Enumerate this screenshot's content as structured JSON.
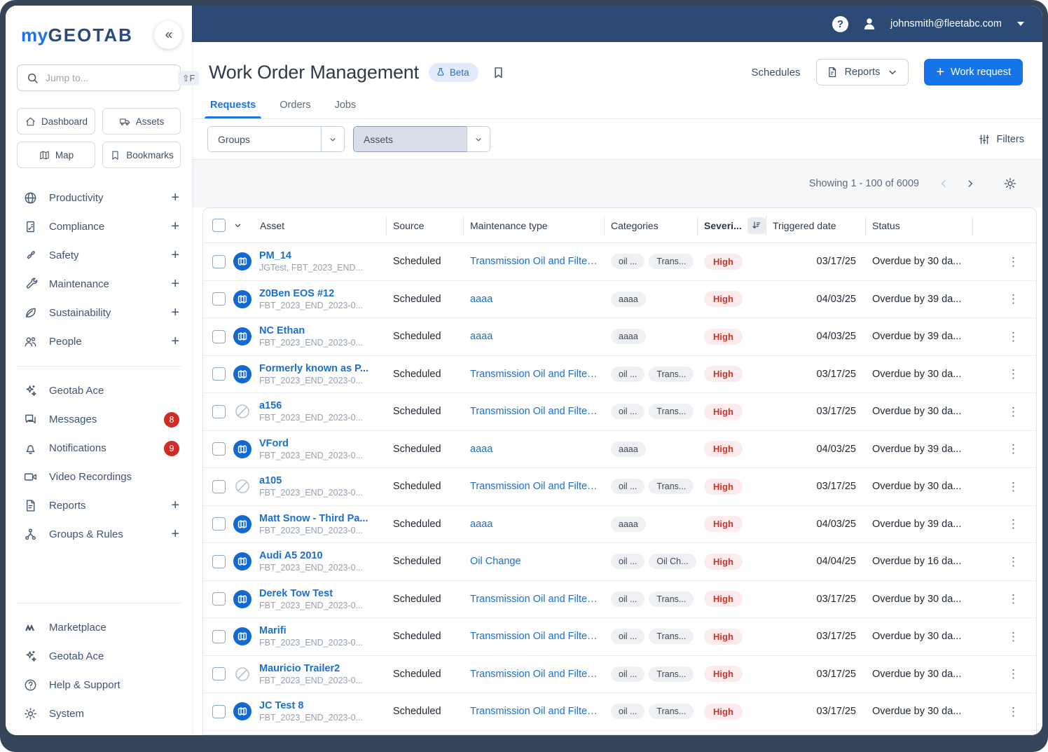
{
  "topbar": {
    "user_email": "johnsmith@fleetabc.com"
  },
  "sidebar": {
    "logo_my": "my",
    "logo_geotab": "GEOTAB",
    "search_placeholder": "Jump to...",
    "search_shortcut": "⇧F",
    "quick_links": [
      {
        "label": "Dashboard",
        "icon": "home"
      },
      {
        "label": "Assets",
        "icon": "truck"
      },
      {
        "label": "Map",
        "icon": "map"
      },
      {
        "label": "Bookmarks",
        "icon": "bookmark"
      }
    ],
    "nav": [
      {
        "label": "Productivity",
        "icon": "globe",
        "expandable": true
      },
      {
        "label": "Compliance",
        "icon": "clipboard",
        "expandable": true
      },
      {
        "label": "Safety",
        "icon": "belt",
        "expandable": true
      },
      {
        "label": "Maintenance",
        "icon": "wrench",
        "expandable": true
      },
      {
        "label": "Sustainability",
        "icon": "leaf",
        "expandable": true
      },
      {
        "label": "People",
        "icon": "people",
        "expandable": true
      }
    ],
    "tools": [
      {
        "label": "Geotab Ace",
        "icon": "sparkle"
      },
      {
        "label": "Messages",
        "icon": "chat",
        "badge": "8"
      },
      {
        "label": "Notifications",
        "icon": "bell",
        "badge": "9"
      },
      {
        "label": "Video Recordings",
        "icon": "video"
      },
      {
        "label": "Reports",
        "icon": "doc",
        "expandable": true
      },
      {
        "label": "Groups & Rules",
        "icon": "hierarchy",
        "expandable": true
      }
    ],
    "footer": [
      {
        "label": "Marketplace",
        "icon": "marketplace"
      },
      {
        "label": "Geotab Ace",
        "icon": "sparkle"
      },
      {
        "label": "Help & Support",
        "icon": "help"
      },
      {
        "label": "System",
        "icon": "gear"
      }
    ]
  },
  "header": {
    "title": "Work Order Management",
    "beta_label": "Beta",
    "schedules_label": "Schedules",
    "reports_label": "Reports",
    "work_request_label": "Work request",
    "tabs": [
      {
        "label": "Requests",
        "active": true
      },
      {
        "label": "Orders",
        "active": false
      },
      {
        "label": "Jobs",
        "active": false
      }
    ]
  },
  "filters": {
    "groups_label": "Groups",
    "assets_label": "Assets",
    "filters_label": "Filters"
  },
  "pagination": {
    "showing": "Showing 1 - 100 of 6009"
  },
  "table": {
    "columns": {
      "asset": "Asset",
      "source": "Source",
      "maintenance_type": "Maintenance type",
      "categories": "Categories",
      "severity": "Severi...",
      "triggered_date": "Triggered date",
      "status": "Status"
    },
    "rows": [
      {
        "asset": "PM_14",
        "subtitle": "JGTest, FBT_2023_END...",
        "icon": "geotab",
        "source": "Scheduled",
        "maintenance_type": "Transmission Oil and Filter...",
        "categories": [
          "oil ...",
          "Trans..."
        ],
        "severity": "High",
        "triggered_date": "03/17/25",
        "status": "Overdue by 30 da..."
      },
      {
        "asset": "Z0Ben EOS #12",
        "subtitle": "FBT_2023_END_2023-0...",
        "icon": "geotab",
        "source": "Scheduled",
        "maintenance_type": "aaaa",
        "categories": [
          "aaaa"
        ],
        "severity": "High",
        "triggered_date": "04/03/25",
        "status": "Overdue by 39 da..."
      },
      {
        "asset": "NC Ethan",
        "subtitle": "FBT_2023_END_2023-0...",
        "icon": "geotab",
        "source": "Scheduled",
        "maintenance_type": "aaaa",
        "categories": [
          "aaaa"
        ],
        "severity": "High",
        "triggered_date": "04/03/25",
        "status": "Overdue by 39 da..."
      },
      {
        "asset": "Formerly known as P...",
        "subtitle": "FBT_2023_END_2023-0...",
        "icon": "geotab",
        "source": "Scheduled",
        "maintenance_type": "Transmission Oil and Filter...",
        "categories": [
          "oil ...",
          "Trans..."
        ],
        "severity": "High",
        "triggered_date": "03/17/25",
        "status": "Overdue by 30 da..."
      },
      {
        "asset": "a156",
        "subtitle": "FBT_2023_END_2023-0...",
        "icon": "no-device",
        "source": "Scheduled",
        "maintenance_type": "Transmission Oil and Filter...",
        "categories": [
          "oil ...",
          "Trans..."
        ],
        "severity": "High",
        "triggered_date": "03/17/25",
        "status": "Overdue by 30 da..."
      },
      {
        "asset": "VFord",
        "subtitle": "FBT_2023_END_2023-0...",
        "icon": "geotab",
        "source": "Scheduled",
        "maintenance_type": "aaaa",
        "categories": [
          "aaaa"
        ],
        "severity": "High",
        "triggered_date": "04/03/25",
        "status": "Overdue by 39 da..."
      },
      {
        "asset": "a105",
        "subtitle": "FBT_2023_END_2023-0...",
        "icon": "no-device",
        "source": "Scheduled",
        "maintenance_type": "Transmission Oil and Filter...",
        "categories": [
          "oil ...",
          "Trans..."
        ],
        "severity": "High",
        "triggered_date": "03/17/25",
        "status": "Overdue by 30 da..."
      },
      {
        "asset": "Matt Snow - Third Pa...",
        "subtitle": "FBT_2023_END_2023-0...",
        "icon": "geotab",
        "source": "Scheduled",
        "maintenance_type": "aaaa",
        "categories": [
          "aaaa"
        ],
        "severity": "High",
        "triggered_date": "04/03/25",
        "status": "Overdue by 39 da..."
      },
      {
        "asset": "Audi A5 2010",
        "subtitle": "FBT_2023_END_2023-0...",
        "icon": "geotab",
        "source": "Scheduled",
        "maintenance_type": "Oil Change",
        "categories": [
          "oil ...",
          "Oil Ch..."
        ],
        "severity": "High",
        "triggered_date": "04/04/25",
        "status": "Overdue by 16 da..."
      },
      {
        "asset": "Derek Tow Test",
        "subtitle": "FBT_2023_END_2023-0...",
        "icon": "geotab",
        "source": "Scheduled",
        "maintenance_type": "Transmission Oil and Filter...",
        "categories": [
          "oil ...",
          "Trans..."
        ],
        "severity": "High",
        "triggered_date": "03/17/25",
        "status": "Overdue by 30 da..."
      },
      {
        "asset": "Marifi",
        "subtitle": "FBT_2023_END_2023-0...",
        "icon": "geotab",
        "source": "Scheduled",
        "maintenance_type": "Transmission Oil and Filter...",
        "categories": [
          "oil ...",
          "Trans..."
        ],
        "severity": "High",
        "triggered_date": "03/17/25",
        "status": "Overdue by 30 da..."
      },
      {
        "asset": "Mauricio Trailer2",
        "subtitle": "FBT_2023_END_2023-0...",
        "icon": "no-device",
        "source": "Scheduled",
        "maintenance_type": "Transmission Oil and Filter...",
        "categories": [
          "oil ...",
          "Trans..."
        ],
        "severity": "High",
        "triggered_date": "03/17/25",
        "status": "Overdue by 30 da..."
      },
      {
        "asset": "JC Test 8",
        "subtitle": "FBT_2023_END_2023-0...",
        "icon": "geotab",
        "source": "Scheduled",
        "maintenance_type": "Transmission Oil and Filter...",
        "categories": [
          "oil ...",
          "Trans..."
        ],
        "severity": "High",
        "triggered_date": "03/17/25",
        "status": "Overdue by 30 da..."
      }
    ]
  },
  "colors": {
    "topbar_navy": "#2b4a76",
    "frame": "#36455a",
    "accent_blue": "#1a73e8",
    "link_blue": "#196fd2",
    "severity_high_bg": "#fcebec",
    "severity_high_text": "#c9342d",
    "badge_red": "#cf2c26"
  }
}
